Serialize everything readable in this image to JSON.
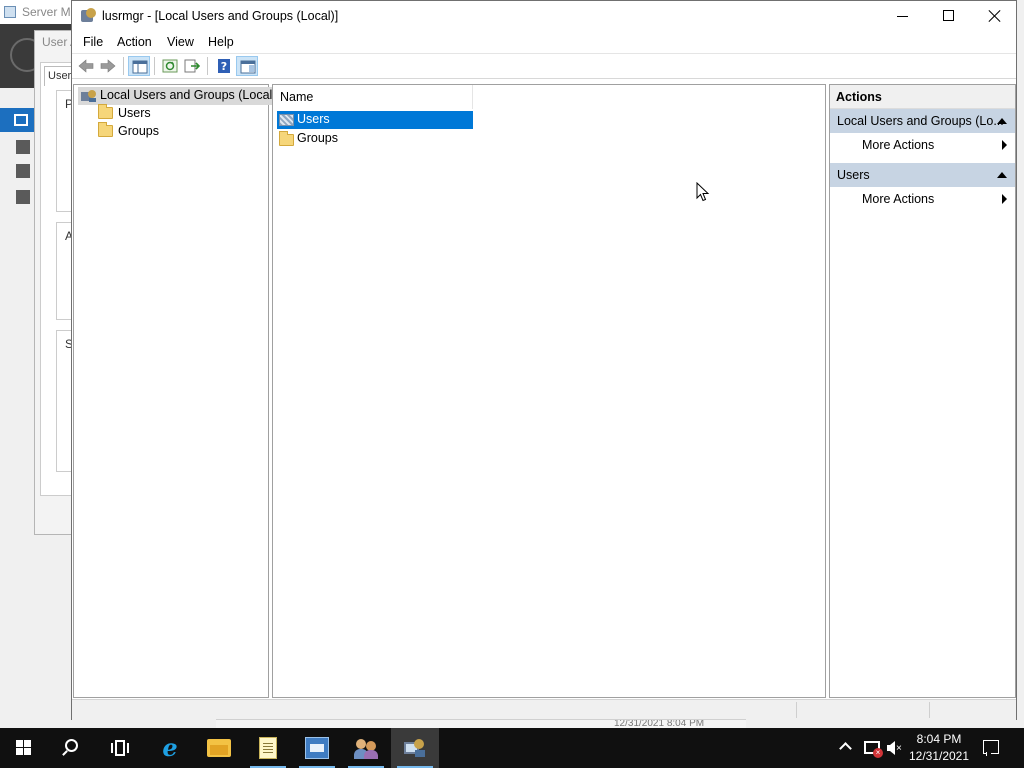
{
  "background": {
    "server_manager_title": "Server Ma",
    "dialog_label": "User A",
    "dialog_tab": "Users",
    "box_letters": [
      "P",
      "A",
      "S"
    ]
  },
  "window": {
    "title": "lusrmgr - [Local Users and Groups (Local)]",
    "controls": {
      "minimize": "minimize",
      "maximize": "maximize",
      "close": "close"
    }
  },
  "menu": [
    "File",
    "Action",
    "View",
    "Help"
  ],
  "toolbar": {
    "buttons": [
      "back",
      "forward",
      "show-hide-console-tree",
      "refresh",
      "export-list",
      "help",
      "show-hide-action-pane"
    ]
  },
  "tree": {
    "root": "Local Users and Groups (Local)",
    "children": [
      "Users",
      "Groups"
    ]
  },
  "list": {
    "column_header": "Name",
    "rows": [
      {
        "label": "Users",
        "selected": true
      },
      {
        "label": "Groups",
        "selected": false
      }
    ]
  },
  "actions": {
    "title": "Actions",
    "groups": [
      {
        "label": "Local Users and Groups (Lo...",
        "item": "More Actions"
      },
      {
        "label": "Users",
        "item": "More Actions"
      }
    ]
  },
  "bg_strip_text": "12/31/2021 8:04 PM",
  "taskbar": {
    "clock_time": "8:04 PM",
    "clock_date": "12/31/2021",
    "colors": {
      "accent": "#0078d7",
      "taskbar": "#101010",
      "action_group": "#c7d4e3"
    }
  }
}
